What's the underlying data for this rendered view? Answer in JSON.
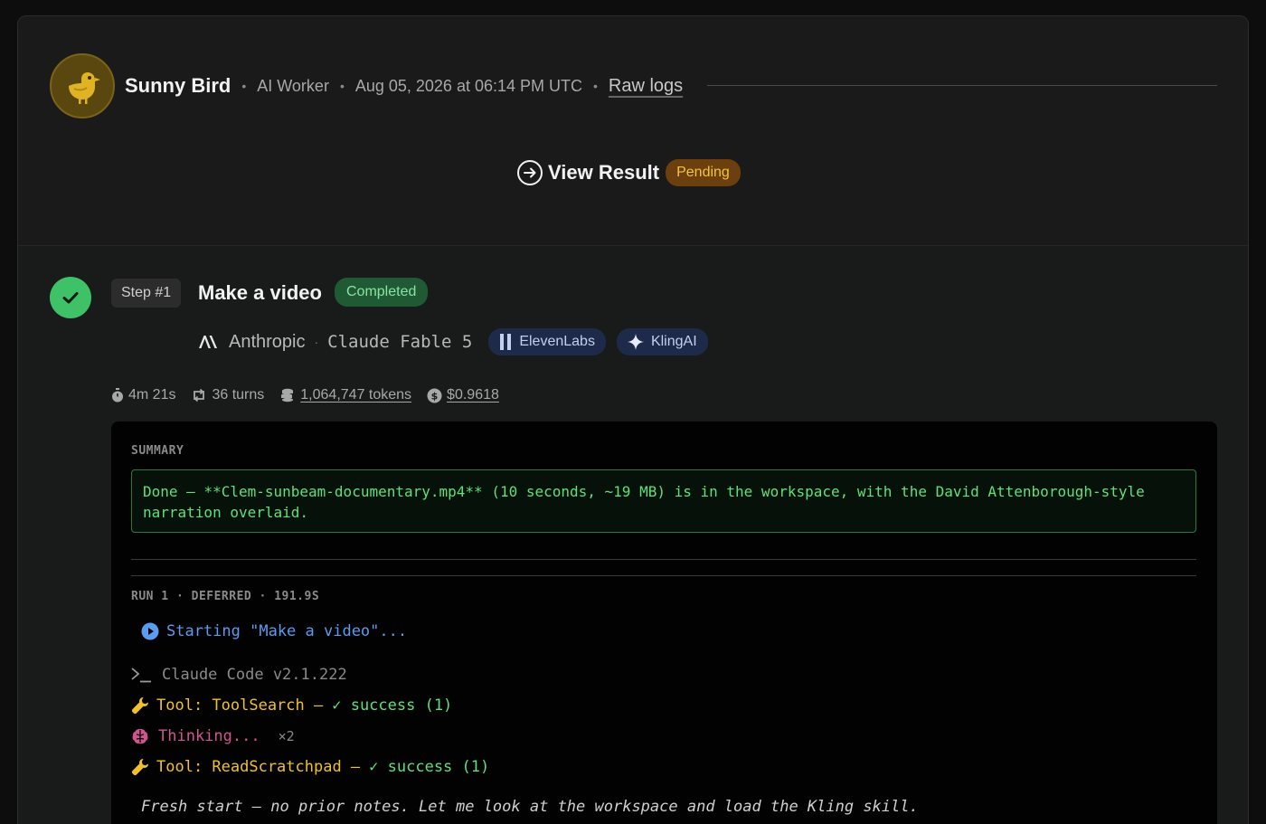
{
  "worker": {
    "name": "Sunny Bird",
    "role": "AI Worker",
    "timestamp": "Aug 05, 2026 at 06:14 PM UTC",
    "raw_logs_label": "Raw logs",
    "avatar_icon": "bird-icon",
    "avatar_bg": "#5a4710",
    "avatar_fg": "#e0b325"
  },
  "result": {
    "label": "View Result",
    "status": "Pending",
    "icon": "arrow-circle-right-icon"
  },
  "step": {
    "badge": "Step #1",
    "title": "Make a video",
    "status": "Completed",
    "status_color": "#3fc168",
    "provider": "Anthropic",
    "model": "Claude Fable 5",
    "integrations": [
      {
        "label": "ElevenLabs",
        "icon": "elevenlabs-icon"
      },
      {
        "label": "KlingAI",
        "icon": "sparkle-icon"
      }
    ],
    "stats": {
      "duration": "4m 21s",
      "turns": "36 turns",
      "tokens": "1,064,747 tokens",
      "cost": "$0.9618"
    }
  },
  "terminal": {
    "summary_label": "SUMMARY",
    "summary_text": "Done — **Clem-sunbeam-documentary.mp4** (10 seconds, ~19 MB) is in the workspace, with the David Attenborough-style narration overlaid.",
    "run_label": "RUN 1 · DEFERRED · 191.9S",
    "start_line": "Starting \"Make a video\"...",
    "cc_line": "Claude Code v2.1.222",
    "tool1_name": "Tool: ToolSearch –",
    "tool1_result": "✓ success (1)",
    "thinking": "Thinking...",
    "thinking_count": "×2",
    "tool2_name": "Tool: ReadScratchpad –",
    "tool2_result": "✓ success (1)",
    "note": "Fresh start — no prior notes. Let me look at the workspace and load the Kling skill."
  }
}
